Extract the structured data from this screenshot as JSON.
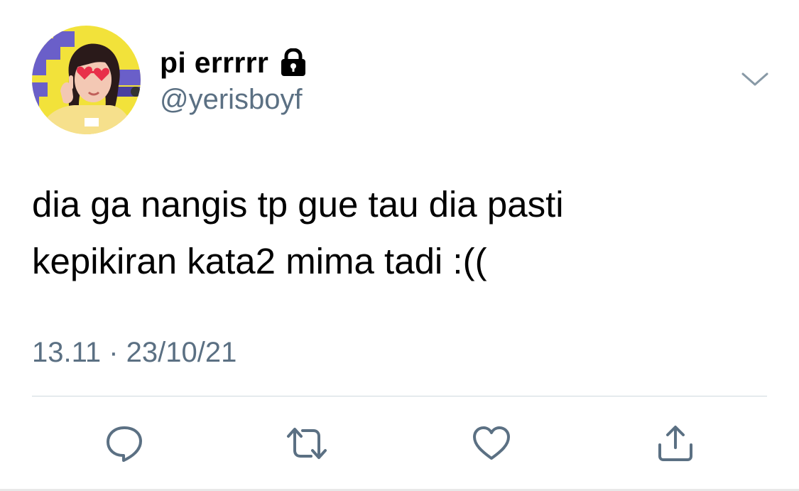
{
  "tweet": {
    "author": {
      "display_name": "pi errrrr",
      "handle": "@yerisboyf",
      "protected_icon": "lock-icon",
      "avatar": "profile-photo"
    },
    "text": "dia ga nangis tp gue tau dia pasti\nkepikiran kata2 mima tadi :((",
    "timestamp": "13.11 · 23/10/21",
    "menu_icon": "chevron-down-icon",
    "actions": [
      {
        "name": "reply",
        "icon": "speech-bubble-icon"
      },
      {
        "name": "retweet",
        "icon": "retweet-icon"
      },
      {
        "name": "like",
        "icon": "heart-icon"
      },
      {
        "name": "share",
        "icon": "share-icon"
      }
    ]
  },
  "colors": {
    "text_primary": "#000000",
    "text_secondary": "#5b7083",
    "divider": "#cfd9de",
    "avatar_bg_yellow": "#f2e23a",
    "avatar_stripes_purple": "#6a5fc9"
  }
}
